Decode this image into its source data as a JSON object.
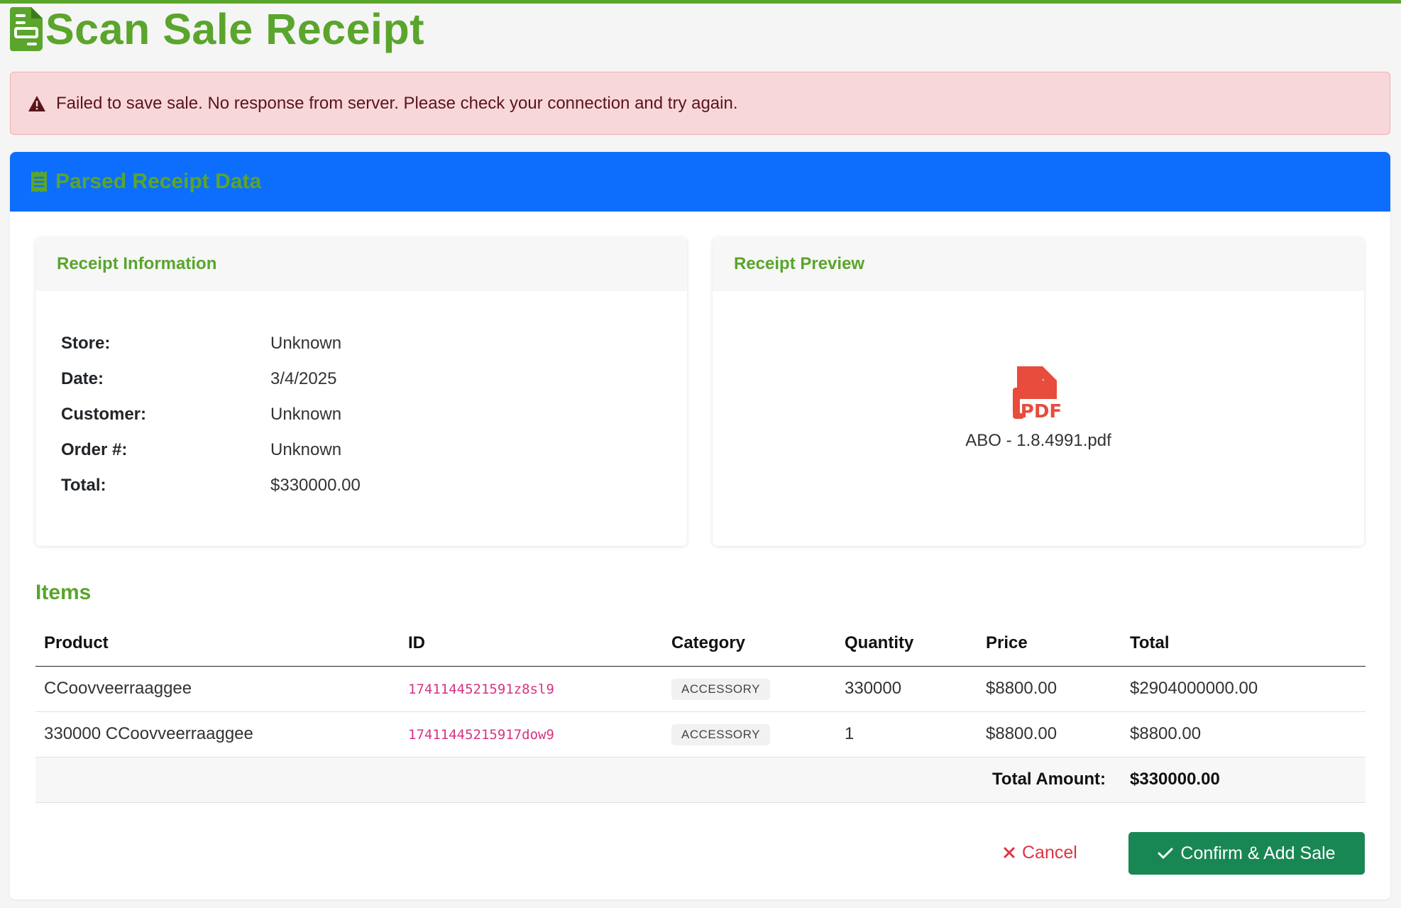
{
  "page": {
    "title": "Scan Sale Receipt"
  },
  "alert": {
    "message": "Failed to save sale. No response from server. Please check your connection and try again."
  },
  "card": {
    "title": "Parsed Receipt Data"
  },
  "receipt_info": {
    "title": "Receipt Information",
    "rows": [
      {
        "label": "Store:",
        "value": "Unknown"
      },
      {
        "label": "Date:",
        "value": "3/4/2025"
      },
      {
        "label": "Customer:",
        "value": "Unknown"
      },
      {
        "label": "Order #:",
        "value": "Unknown"
      },
      {
        "label": "Total:",
        "value": "$330000.00"
      }
    ]
  },
  "receipt_preview": {
    "title": "Receipt Preview",
    "file_name": "ABO - 1.8.4991.pdf",
    "icon_label": "PDF"
  },
  "items": {
    "title": "Items",
    "columns": [
      "Product",
      "ID",
      "Category",
      "Quantity",
      "Price",
      "Total"
    ],
    "rows": [
      {
        "product": "CCoovveerraaggee",
        "id": "1741144521591z8sl9",
        "category": "ACCESSORY",
        "quantity": "330000",
        "price": "$8800.00",
        "total": "$2904000000.00"
      },
      {
        "product": "330000 CCoovveerraaggee",
        "id": "17411445215917dow9",
        "category": "ACCESSORY",
        "quantity": "1",
        "price": "$8800.00",
        "total": "$8800.00"
      }
    ],
    "total_label": "Total Amount:",
    "total_value": "$330000.00"
  },
  "actions": {
    "cancel": "Cancel",
    "confirm": "Confirm & Add Sale"
  },
  "colors": {
    "brand_green": "#5aa52c",
    "header_blue": "#0d6efd",
    "alert_bg": "#f8d7da",
    "danger": "#dc3545",
    "success": "#198754",
    "pdf_red": "#e74c3c"
  }
}
